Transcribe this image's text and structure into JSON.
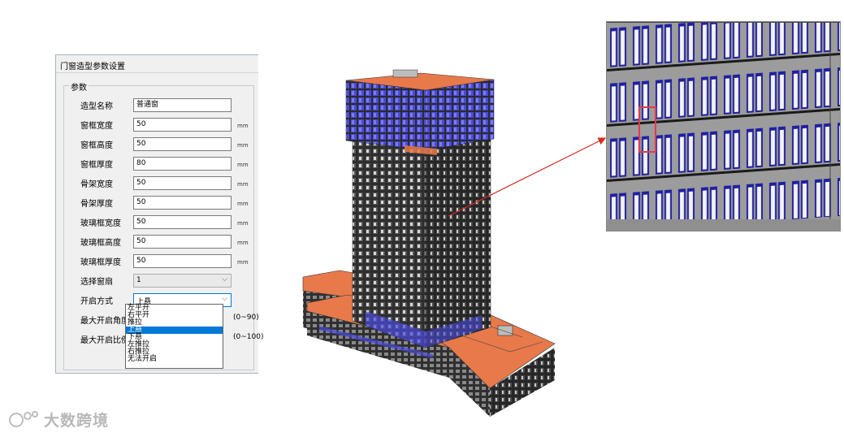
{
  "dialog": {
    "title": "门窗造型参数设置",
    "group_label": "参数",
    "fields": [
      {
        "label": "造型名称",
        "value": "普通窗",
        "unit": ""
      },
      {
        "label": "窗框宽度",
        "value": "50",
        "unit": "mm"
      },
      {
        "label": "窗框高度",
        "value": "50",
        "unit": "mm"
      },
      {
        "label": "窗框厚度",
        "value": "80",
        "unit": "mm"
      },
      {
        "label": "骨架宽度",
        "value": "50",
        "unit": "mm"
      },
      {
        "label": "骨架厚度",
        "value": "50",
        "unit": "mm"
      },
      {
        "label": "玻璃框宽度",
        "value": "50",
        "unit": "mm"
      },
      {
        "label": "玻璃框高度",
        "value": "50",
        "unit": "mm"
      },
      {
        "label": "玻璃框厚度",
        "value": "50",
        "unit": "mm"
      }
    ],
    "sash": {
      "label": "选择窗扇",
      "value": "1"
    },
    "open_mode": {
      "label": "开启方式",
      "value": "上悬",
      "options": [
        "左平开",
        "右平开",
        "推拉",
        "上悬",
        "下悬",
        "左推拉",
        "右推拉",
        "无法开启"
      ],
      "selected_index": 3
    },
    "max_angle": {
      "label": "最大开启角度",
      "range": "(0~90)"
    },
    "max_ratio": {
      "label": "最大开启比例",
      "range": "(0~100)"
    }
  },
  "colors": {
    "roof": "#e8794a",
    "facade": "#3a3a3a",
    "glass": "#3a3ab8",
    "arrow": "#d62d20",
    "highlight_window": "#e23a4a"
  },
  "watermark": {
    "text": "大数跨境"
  }
}
